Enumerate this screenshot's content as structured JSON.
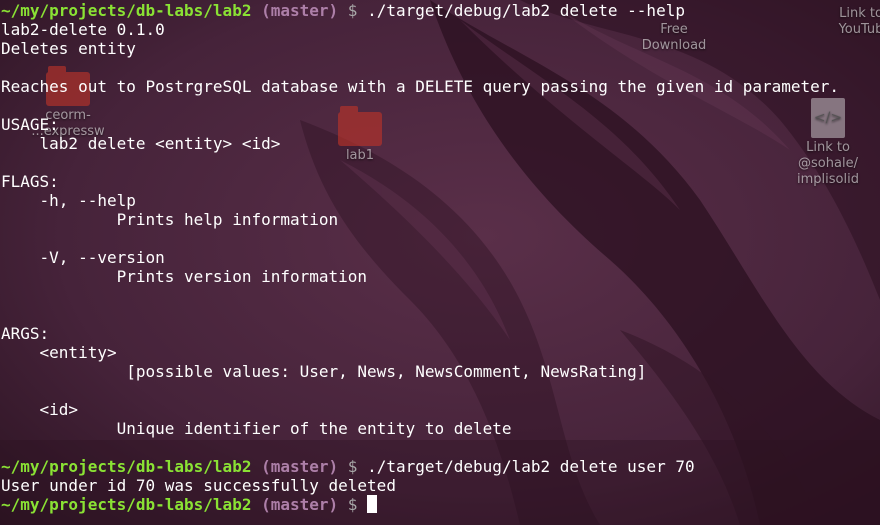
{
  "desktop": {
    "icons": [
      {
        "name": "prisma-express-folder",
        "label": "ceorm-\n...expressw",
        "type": "folder"
      },
      {
        "name": "lab1-folder",
        "label": "lab1",
        "type": "folder"
      },
      {
        "name": "free-download-link",
        "label": "Free\nDownload",
        "type": "link"
      },
      {
        "name": "link-to-sohale-file",
        "label": "Link to\n@sohale/\nimplisolid",
        "type": "document"
      },
      {
        "name": "link-to-youtube",
        "label": "Link to\nYouTub",
        "type": "link"
      }
    ]
  },
  "terminal": {
    "prompt": {
      "path": "~/my/projects/db-labs/lab2",
      "branch": "(master)",
      "symbol": "$"
    },
    "lines": [
      {
        "kind": "command",
        "command": "./target/debug/lab2 delete --help"
      },
      {
        "kind": "output",
        "text": "lab2-delete 0.1.0"
      },
      {
        "kind": "output",
        "text": "Deletes entity"
      },
      {
        "kind": "output",
        "text": ""
      },
      {
        "kind": "output",
        "text": "Reaches out to PostrgreSQL database with a DELETE query passing the given id parameter."
      },
      {
        "kind": "output",
        "text": ""
      },
      {
        "kind": "output",
        "text": "USAGE:"
      },
      {
        "kind": "output",
        "text": "    lab2 delete <entity> <id>"
      },
      {
        "kind": "output",
        "text": ""
      },
      {
        "kind": "output",
        "text": "FLAGS:"
      },
      {
        "kind": "output",
        "text": "    -h, --help"
      },
      {
        "kind": "output",
        "text": "            Prints help information"
      },
      {
        "kind": "output",
        "text": ""
      },
      {
        "kind": "output",
        "text": "    -V, --version"
      },
      {
        "kind": "output",
        "text": "            Prints version information"
      },
      {
        "kind": "output",
        "text": ""
      },
      {
        "kind": "output",
        "text": ""
      },
      {
        "kind": "output",
        "text": "ARGS:"
      },
      {
        "kind": "output",
        "text": "    <entity>"
      },
      {
        "kind": "output",
        "text": "             [possible values: User, News, NewsComment, NewsRating]"
      },
      {
        "kind": "output",
        "text": ""
      },
      {
        "kind": "output",
        "text": "    <id>"
      },
      {
        "kind": "output",
        "text": "            Unique identifier of the entity to delete"
      },
      {
        "kind": "output",
        "text": ""
      },
      {
        "kind": "command",
        "command": "./target/debug/lab2 delete user 70"
      },
      {
        "kind": "output",
        "text": "User under id 70 was successfully deleted"
      },
      {
        "kind": "prompt",
        "command": ""
      }
    ],
    "colors": {
      "path": "#8ae234",
      "branch": "#ad7fa8",
      "symbol": "#a8a8a8",
      "text": "#ffffff",
      "background": "#3b1b2e"
    }
  }
}
